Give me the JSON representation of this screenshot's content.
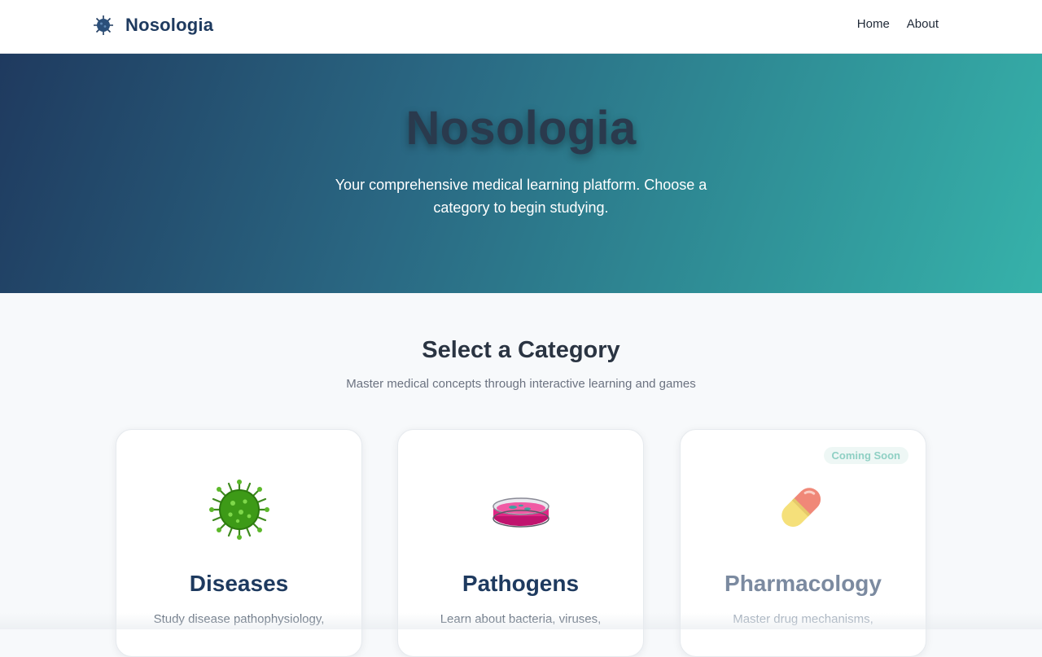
{
  "navbar": {
    "brand_name": "Nosologia",
    "brand_icon": "virus-icon",
    "links": [
      {
        "label": "Home"
      },
      {
        "label": "About"
      }
    ]
  },
  "hero": {
    "title": "Nosologia",
    "subtitle": "Your comprehensive medical learning platform. Choose a category to begin studying."
  },
  "section": {
    "title": "Select a Category",
    "subtitle": "Master medical concepts through interactive learning and games"
  },
  "cards": [
    {
      "icon": "virus-icon",
      "title": "Diseases",
      "description": "Study disease pathophysiology,"
    },
    {
      "icon": "petri-dish-icon",
      "title": "Pathogens",
      "description": "Learn about bacteria, viruses,"
    },
    {
      "icon": "pill-icon",
      "title": "Pharmacology",
      "description": "Master drug mechanisms,",
      "badge": "Coming Soon"
    }
  ],
  "colors": {
    "brand_navy": "#1e3a5f",
    "hero_gradient_start": "#1f3a5f",
    "hero_gradient_end": "#36b2aa",
    "badge_text": "#8fd0c4"
  }
}
